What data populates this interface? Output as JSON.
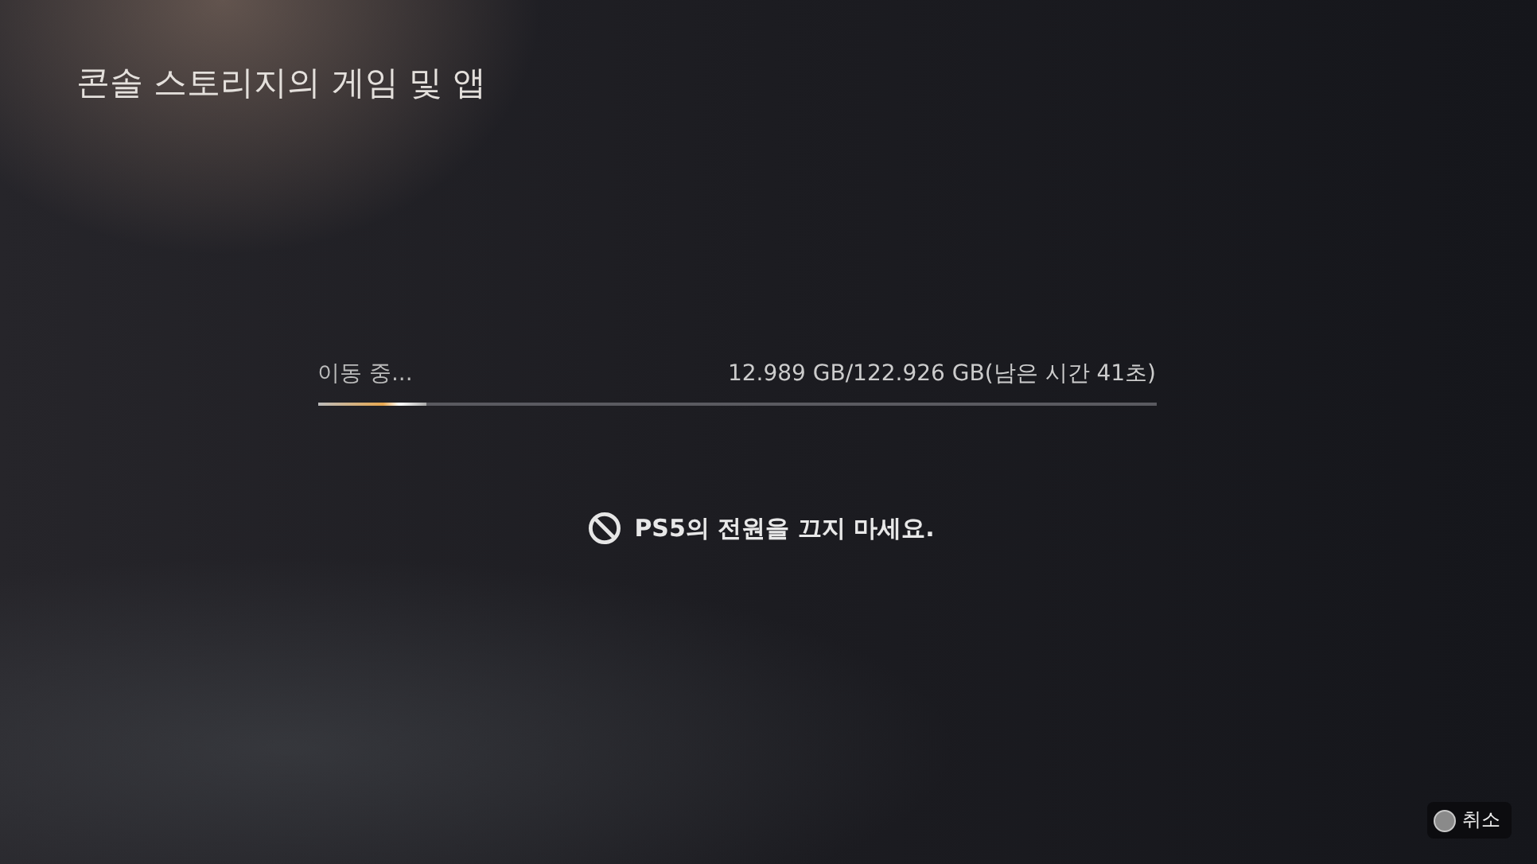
{
  "header": {
    "title": "콘솔 스토리지의 게임 및 앱"
  },
  "progress": {
    "label": "이동 중...",
    "reading": "12.989 GB/122.926 GB(남은 시간 41초)",
    "level": 0.13
  },
  "warning": {
    "text": "PS5의 전원을 끄지 마세요."
  },
  "footer": {
    "buttons": [
      {
        "kind": "circle",
        "label": "취소"
      }
    ]
  }
}
